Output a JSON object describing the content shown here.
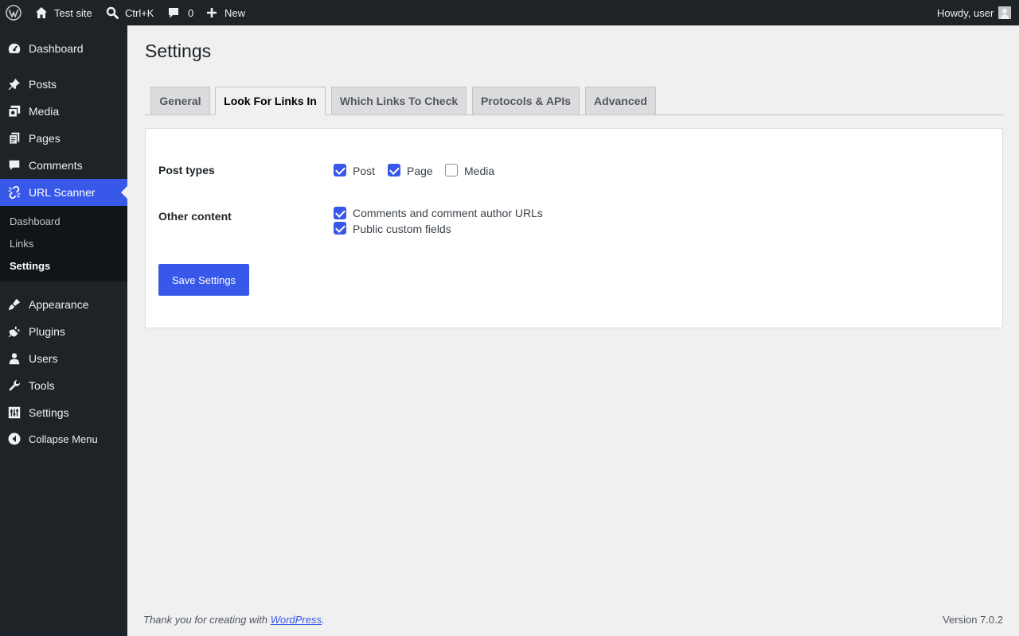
{
  "adminbar": {
    "site_name": "Test site",
    "search_shortcut": "Ctrl+K",
    "comments_count": "0",
    "new_label": "New",
    "greeting": "Howdy, user"
  },
  "sidebar": {
    "items": [
      {
        "label": "Dashboard",
        "icon": "dashboard-icon"
      },
      {
        "label": "Posts",
        "icon": "pin-icon"
      },
      {
        "label": "Media",
        "icon": "media-icon"
      },
      {
        "label": "Pages",
        "icon": "pages-icon"
      },
      {
        "label": "Comments",
        "icon": "comment-icon"
      },
      {
        "label": "URL Scanner",
        "icon": "broken-link-icon"
      },
      {
        "label": "Appearance",
        "icon": "brush-icon"
      },
      {
        "label": "Plugins",
        "icon": "plug-icon"
      },
      {
        "label": "Users",
        "icon": "user-icon"
      },
      {
        "label": "Tools",
        "icon": "wrench-icon"
      },
      {
        "label": "Settings",
        "icon": "settings-icon"
      }
    ],
    "submenu": [
      "Dashboard",
      "Links",
      "Settings"
    ],
    "collapse_label": "Collapse Menu"
  },
  "page": {
    "title": "Settings",
    "tabs": [
      "General",
      "Look For Links In",
      "Which Links To Check",
      "Protocols & APIs",
      "Advanced"
    ],
    "active_tab": "Look For Links In"
  },
  "form": {
    "post_types_label": "Post types",
    "post_types": [
      {
        "label": "Post",
        "checked": true
      },
      {
        "label": "Page",
        "checked": true
      },
      {
        "label": "Media",
        "checked": false
      }
    ],
    "other_content_label": "Other content",
    "other_content": [
      {
        "label": "Comments and comment author URLs",
        "checked": true
      },
      {
        "label": "Public custom fields",
        "checked": true
      }
    ],
    "save_label": "Save Settings"
  },
  "footer": {
    "thanks_prefix": "Thank you for creating with ",
    "thanks_link": "WordPress",
    "thanks_suffix": ".",
    "version": "Version 7.0.2"
  },
  "colors": {
    "accent": "#3858e9",
    "adminbar_bg": "#1d2327",
    "page_bg": "#f0f0f1"
  }
}
